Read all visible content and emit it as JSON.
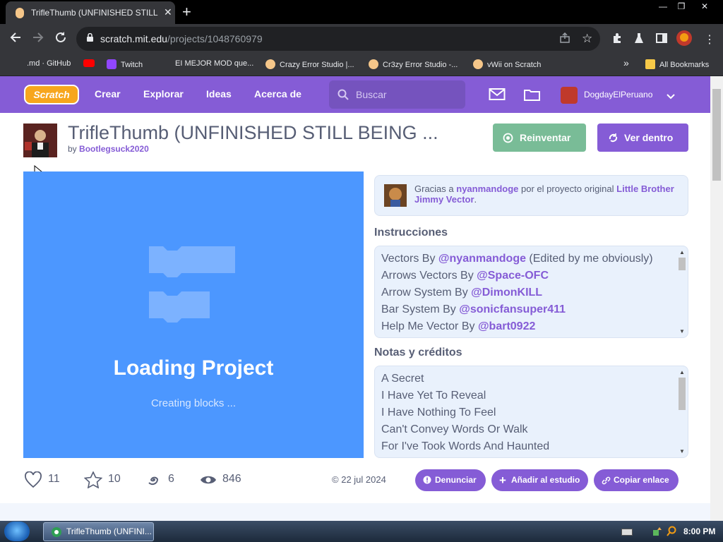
{
  "browser": {
    "tab_title": "TrifleThumb (UNFINISHED STILL BEING",
    "tab_close": "✕",
    "new_tab": "+",
    "url_host": "scratch.mit.edu",
    "url_path": "/projects/1048760979",
    "window": {
      "minimize": "—",
      "restore": "❐",
      "close": "✕"
    },
    "bookmarks": [
      {
        "label": ".md · GitHub",
        "icon_color": "#35363a"
      },
      {
        "label": "Twitch",
        "icon_color": "#9146ff"
      },
      {
        "label": "EI MEJOR MOD que...",
        "icon_color": "#35363a"
      },
      {
        "label": "Crazy Error Studio |...",
        "icon_color": "#f5c689"
      },
      {
        "label": "Cr3zy Error Studio -...",
        "icon_color": "#f5c689"
      },
      {
        "label": "vWii on Scratch",
        "icon_color": "#f5c689"
      }
    ],
    "youtube_icon_color": "#ff0000",
    "more_bookmarks": "»",
    "all_bookmarks": "All Bookmarks"
  },
  "scratch_nav": {
    "logo": "Scratch",
    "links": [
      "Crear",
      "Explorar",
      "Ideas",
      "Acerca de"
    ],
    "search_placeholder": "Buscar",
    "username": "DogdayElPeruano"
  },
  "project": {
    "title": "TrifleThumb (UNFINISHED STILL BEING ...",
    "by_prefix": "by",
    "author": "Bootlegsuck2020",
    "remix_label": "Reinventar",
    "see_inside_label": "Ver dentro",
    "loading_title": "Loading Project",
    "loading_sub": "Creating blocks ...",
    "credit": {
      "prefix": "Gracias a",
      "user": "nyanmandoge",
      "middle": "por el proyecto original",
      "project": "Little Brother Jimmy Vector",
      "suffix": "."
    },
    "instructions_heading": "Instrucciones",
    "instructions": [
      {
        "text": "Vectors By ",
        "mention": "@nyanmandoge",
        "after": " (Edited by me obviously)"
      },
      {
        "text": "Arrows Vectors By ",
        "mention": "@Space-OFC",
        "after": ""
      },
      {
        "text": "Arrow System By ",
        "mention": "@DimonKILL",
        "after": ""
      },
      {
        "text": "Bar System By ",
        "mention": "@sonicfansuper411",
        "after": ""
      },
      {
        "text": "Help Me Vector By ",
        "mention": "@bart0922",
        "after": ""
      }
    ],
    "notes_heading": "Notas y créditos",
    "notes": [
      "A Secret",
      "I Have Yet To Reveal",
      "I Have Nothing To Feel",
      "Can't Convey Words Or Walk",
      "For I've Took Words And Haunted"
    ],
    "stats": {
      "loves": "11",
      "favorites": "10",
      "remixes": "6",
      "views": "846"
    },
    "date": "22 jul 2024",
    "report_label": "Denunciar",
    "add_studio_label": "Añadir al estudio",
    "copy_link_label": "Copiar enlace"
  },
  "taskbar": {
    "item": "TrifleThumb (UNFINI...",
    "clock": "8:00 PM"
  },
  "colors": {
    "scratch_purple": "#855cd6",
    "remix_green": "#79bc97",
    "stage_blue": "#4c97ff"
  }
}
